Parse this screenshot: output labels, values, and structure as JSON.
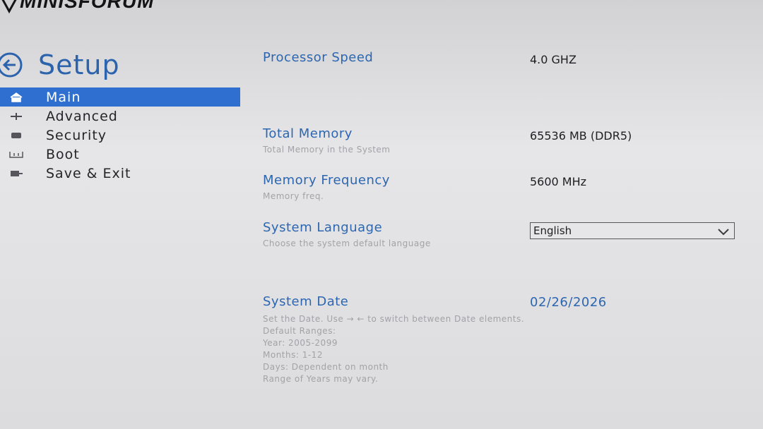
{
  "brand": "MINISFORUM",
  "header": {
    "title": "Setup"
  },
  "sidebar": {
    "items": [
      {
        "label": "Main",
        "icon": "home-icon",
        "active": true
      },
      {
        "label": "Advanced",
        "icon": "advanced-icon",
        "active": false
      },
      {
        "label": "Security",
        "icon": "security-icon",
        "active": false
      },
      {
        "label": "Boot",
        "icon": "boot-icon",
        "active": false
      },
      {
        "label": "Save & Exit",
        "icon": "save-exit-icon",
        "active": false
      }
    ]
  },
  "main": {
    "processor_speed": {
      "label": "Processor Speed",
      "value": "4.0 GHZ"
    },
    "total_memory": {
      "label": "Total Memory",
      "value": "65536 MB (DDR5)",
      "help": "Total Memory in the System"
    },
    "memory_frequency": {
      "label": "Memory Frequency",
      "value": "5600 MHz",
      "help": "Memory freq."
    },
    "system_language": {
      "label": "System Language",
      "value": "English",
      "help": "Choose the system default language"
    },
    "system_date": {
      "label": "System Date",
      "value": "02/26/2026",
      "help": [
        "Set the Date. Use → ← to switch between Date elements.",
        "Default Ranges:",
        "Year: 2005-2099",
        "Months: 1-12",
        "Days: Dependent on month",
        "Range of Years may vary."
      ]
    }
  },
  "colors": {
    "accent": "#2f6fcf",
    "label_blue": "#2c66b0",
    "background": "#e0e0e2",
    "help_text": "#a2a2a8"
  }
}
